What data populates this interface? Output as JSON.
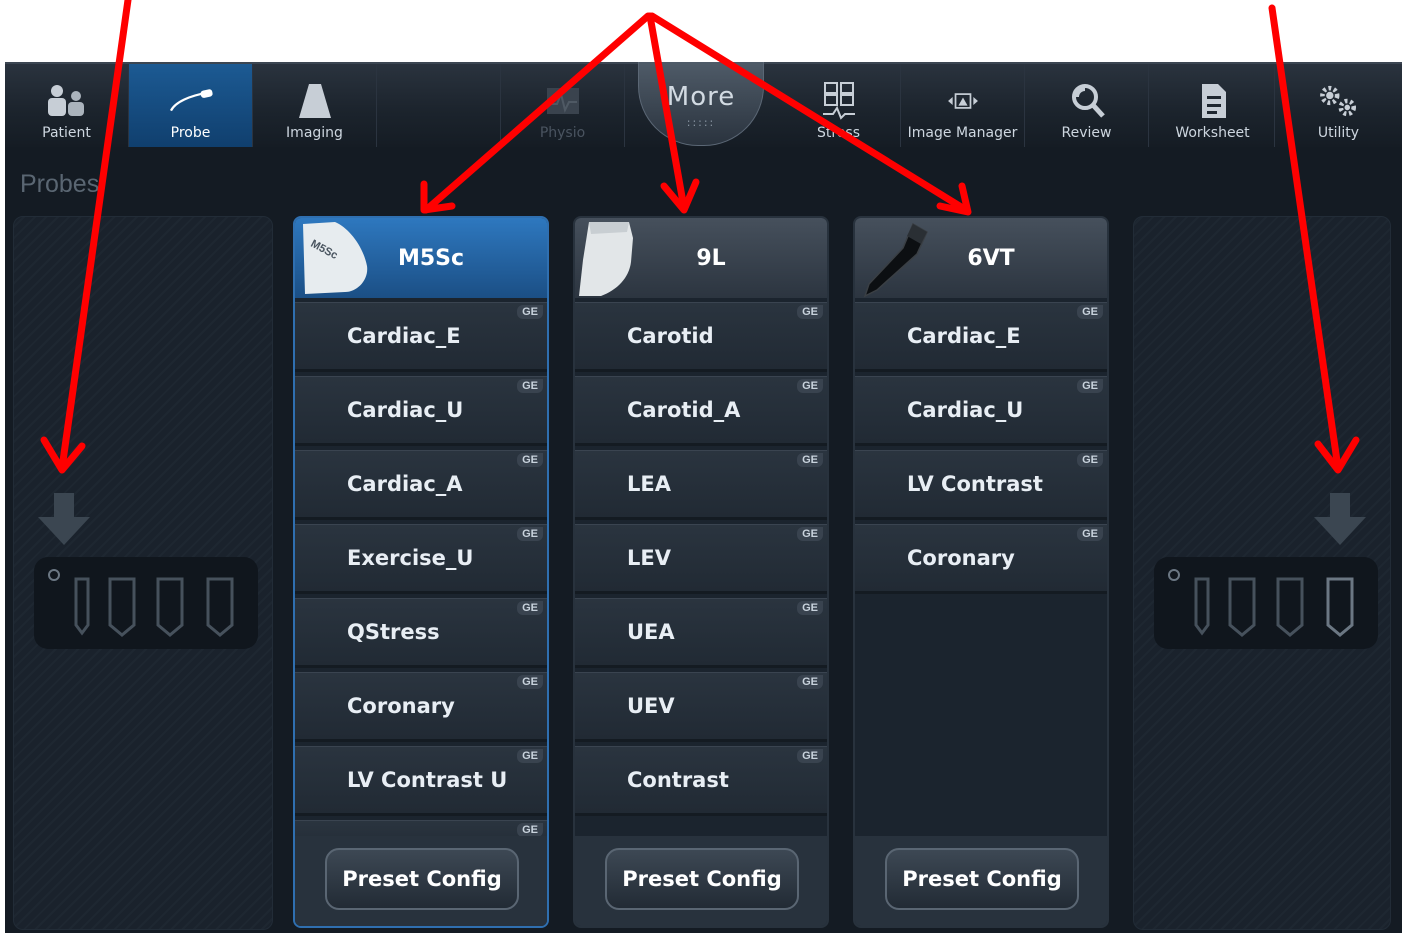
{
  "toolbar": {
    "items": [
      {
        "label": "Patient",
        "icon": "patient-icon",
        "state": "normal"
      },
      {
        "label": "Probe",
        "icon": "probe-icon",
        "state": "active"
      },
      {
        "label": "Imaging",
        "icon": "imaging-icon",
        "state": "normal"
      },
      {
        "label": "",
        "icon": "",
        "state": "empty"
      },
      {
        "label": "Physio",
        "icon": "physio-icon",
        "state": "disabled"
      },
      {
        "label": "Stress",
        "icon": "stress-icon",
        "state": "normal"
      },
      {
        "label": "Image Manager",
        "icon": "image-manager-icon",
        "state": "normal"
      },
      {
        "label": "Review",
        "icon": "review-icon",
        "state": "normal"
      },
      {
        "label": "Worksheet",
        "icon": "worksheet-icon",
        "state": "normal"
      },
      {
        "label": "Utility",
        "icon": "utility-icon",
        "state": "normal"
      }
    ],
    "more_label": "More",
    "more_dots": ":::::"
  },
  "section_title": "Probes",
  "ge_tag": "GE",
  "probes": [
    {
      "name": "M5Sc",
      "probe_icon_text": "M5Sc",
      "selected": true,
      "presets": [
        "Cardiac_E",
        "Cardiac_U",
        "Cardiac_A",
        "Exercise_U",
        "QStress",
        "Coronary",
        "LV Contrast U"
      ],
      "config_label": "Preset Config"
    },
    {
      "name": "9L",
      "selected": false,
      "presets": [
        "Carotid",
        "Carotid_A",
        "LEA",
        "LEV",
        "UEA",
        "UEV",
        "Contrast"
      ],
      "config_label": "Preset Config"
    },
    {
      "name": "6VT",
      "selected": false,
      "presets": [
        "Cardiac_E",
        "Cardiac_U",
        "LV Contrast",
        "Coronary"
      ],
      "config_label": "Preset Config"
    }
  ],
  "colors": {
    "accent": "#1b5a96",
    "annotation_arrow": "#ff0000",
    "background": "#141b23"
  }
}
